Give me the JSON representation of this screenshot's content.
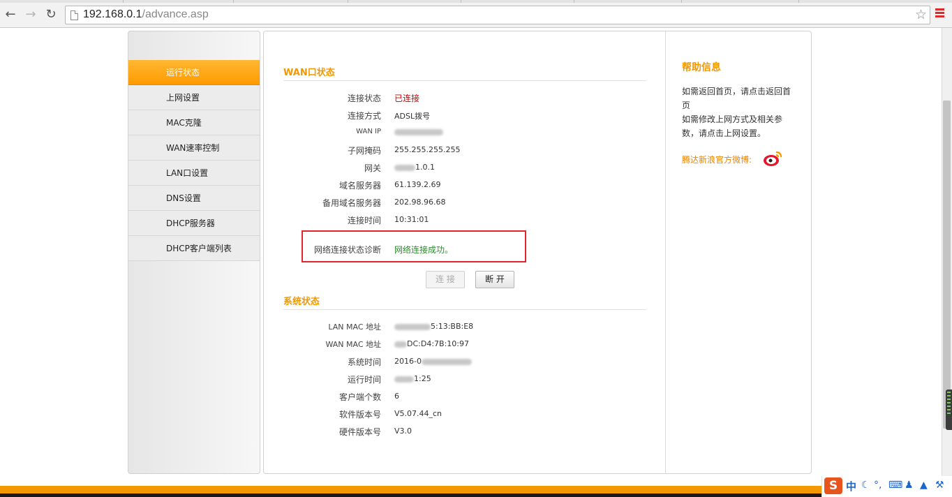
{
  "browser": {
    "url_host": "192.168.0.1",
    "url_path": "/advance.asp"
  },
  "sidebar": {
    "items": [
      {
        "label": "运行状态",
        "active": true
      },
      {
        "label": "上网设置"
      },
      {
        "label": "MAC克隆"
      },
      {
        "label": "WAN速率控制"
      },
      {
        "label": "LAN口设置"
      },
      {
        "label": "DNS设置"
      },
      {
        "label": "DHCP服务器"
      },
      {
        "label": "DHCP客户端列表"
      }
    ]
  },
  "wan": {
    "title": "WAN口状态",
    "rows": [
      {
        "label": "连接状态",
        "value": "已连接"
      },
      {
        "label": "连接方式",
        "value": "ADSL拨号"
      },
      {
        "label": "WAN IP",
        "value": ""
      },
      {
        "label": "子网掩码",
        "value": "255.255.255.255"
      },
      {
        "label": "网关",
        "value": "1.0.1"
      },
      {
        "label": "域名服务器",
        "value": "61.139.2.69"
      },
      {
        "label": "备用域名服务器",
        "value": "202.98.96.68"
      },
      {
        "label": "连接时间",
        "value": "10:31:01"
      }
    ],
    "diagnosis_label": "网络连接状态诊断",
    "diagnosis_value": "网络连接成功。",
    "connect_button": "连 接",
    "disconnect_button": "断 开"
  },
  "system": {
    "title": "系统状态",
    "rows": [
      {
        "label": "LAN MAC 地址",
        "value": "5:13:BB:E8"
      },
      {
        "label": "WAN MAC 地址",
        "value": "DC:D4:7B:10:97"
      },
      {
        "label": "系统时间",
        "value": "2016-0"
      },
      {
        "label": "运行时间",
        "value": "1:25"
      },
      {
        "label": "客户端个数",
        "value": "6"
      },
      {
        "label": "软件版本号",
        "value": "V5.07.44_cn"
      },
      {
        "label": "硬件版本号",
        "value": "V3.0"
      }
    ]
  },
  "help": {
    "title": "帮助信息",
    "text1": "如需返回首页，请点击返回首页",
    "text2": "如需修改上网方式及相关参数，请点击上网设置。",
    "weibo_label": "腾达新浪官方微博:"
  },
  "ime": {
    "logo": "S",
    "mode": "中"
  },
  "colors": {
    "accent": "#f39800",
    "active_menu": "#ff9a00",
    "connected": "#d00000",
    "success": "#2e8b2e",
    "highlight_box": "#e0262c"
  }
}
